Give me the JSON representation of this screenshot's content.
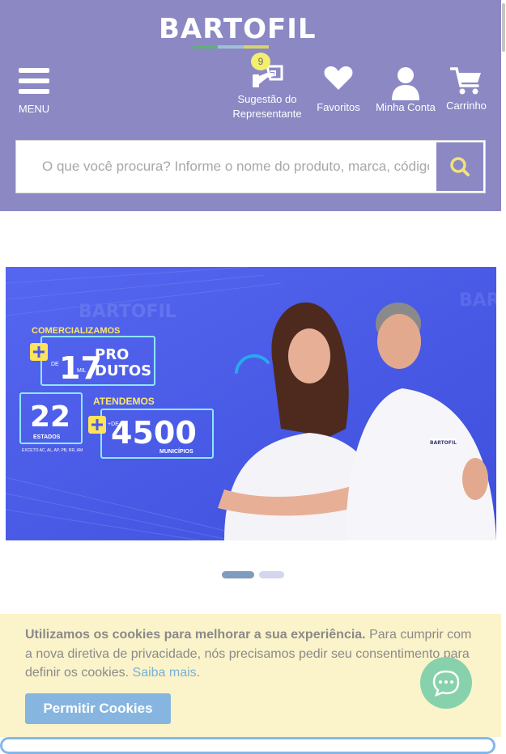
{
  "brand": {
    "name": "BARTOFIL",
    "stripe_colors": [
      "#5fb075",
      "#9ec1d8",
      "#d8d46a"
    ]
  },
  "header": {
    "menu_label": "MENU",
    "nav": [
      {
        "label_line1": "Sugestão do",
        "label_line2": "Representante",
        "icon": "rep-suggestion-icon",
        "badge": "9"
      },
      {
        "label_line1": "Favoritos",
        "label_line2": "",
        "icon": "heart-icon"
      },
      {
        "label_line1": "Minha Conta",
        "label_line2": "",
        "icon": "user-icon"
      },
      {
        "label_line1": "Carrinho",
        "label_line2": "",
        "icon": "cart-icon"
      }
    ]
  },
  "search": {
    "placeholder": "O que você procura? Informe o nome do produto, marca, código",
    "value": "",
    "icon": "search-icon"
  },
  "banner": {
    "left_block": {
      "line1": "COMERCIALIZAMOS",
      "products_count": "17",
      "products_unit": "MIL",
      "products_word1": "PRO",
      "products_word2": "DUTOS",
      "states_count": "22",
      "states_word": "ESTADOS",
      "states_list": "EXCETO AC, AL, AP, PB, RR, AM",
      "serve_word": "ATENDEMOS",
      "cities_prefix": "+DE",
      "cities_count": "4500",
      "cities_word": "MUNICÍPIOS"
    },
    "shirt_logo": "BARTOFIL",
    "bg_logo": "BARTOFIL",
    "slides": 2,
    "active_slide": 1
  },
  "cookie": {
    "bold_text": "Utilizamos os cookies para melhorar a sua experiência.",
    "text": " Para cumprir com a nova diretiva de privacidade, nós precisamos pedir seu consentimento para definir os cookies. ",
    "link": "Saiba mais",
    "after_link": ".",
    "button": "Permitir Cookies"
  },
  "colors": {
    "header_bg": "#8b88c4",
    "banner_bg": "#4a5ae8",
    "cookie_bg": "#fbf3c9",
    "cookie_button": "#86b6e0",
    "chat_button": "#87d1ac",
    "badge": "#f4ef6e",
    "dot_active": "#7f9bbd",
    "dot_inactive": "#d3d6ee"
  }
}
